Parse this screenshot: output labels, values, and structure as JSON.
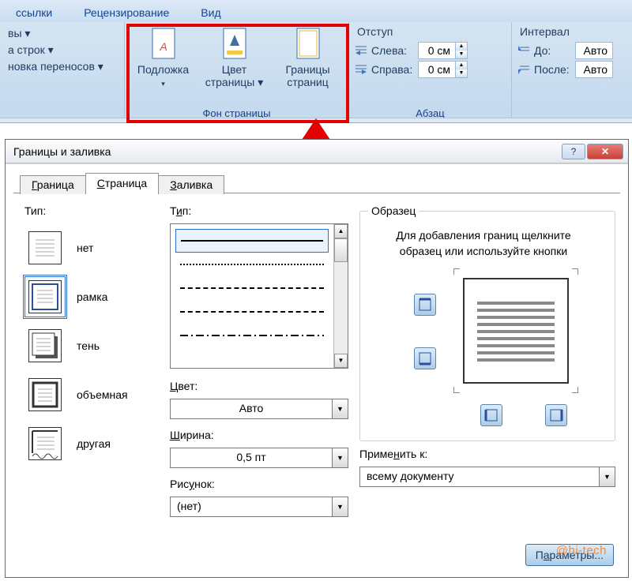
{
  "ribbon": {
    "tabs": {
      "references": "ссылки",
      "review": "Рецензирование",
      "view": "Вид"
    },
    "group1": {
      "btn1": "вы ▾",
      "btn2": "а строк ▾",
      "btn3": "новка переносов ▾"
    },
    "pagebg": {
      "watermark": "Подложка",
      "pagecolor": "Цвет\nстраницы",
      "borders": "Границы\nстраниц",
      "title": "Фон страницы"
    },
    "indent": {
      "title": "Отступ",
      "left": "Слева:",
      "right": "Справа:",
      "left_val": "0 см",
      "right_val": "0 см"
    },
    "spacing": {
      "title": "Интервал",
      "before": "До:",
      "after": "После:",
      "before_val": "Авто",
      "after_val": "Авто"
    },
    "para_title": "Абзац"
  },
  "dialog": {
    "title": "Границы и заливка",
    "help": "?",
    "close": "✕",
    "tabs": {
      "border": "Граница",
      "page": "Страница",
      "shading": "Заливка"
    },
    "type_label": "Тип:",
    "types": {
      "none": "нет",
      "box": "рамка",
      "shadow": "тень",
      "threeD": "объемная",
      "custom": "другая"
    },
    "style_label": "Тип:",
    "color_label": "Цвет:",
    "color_val": "Авто",
    "width_label": "Ширина:",
    "width_val": "0,5 пт",
    "art_label": "Рисунок:",
    "art_val": "(нет)",
    "preview_label": "Образец",
    "preview_hint": "Для добавления границ щелкните образец или используйте кнопки",
    "apply_label": "Применить к:",
    "apply_val": "всему документу",
    "options_btn": "Параметры...",
    "watermark": "@hi-tech"
  }
}
